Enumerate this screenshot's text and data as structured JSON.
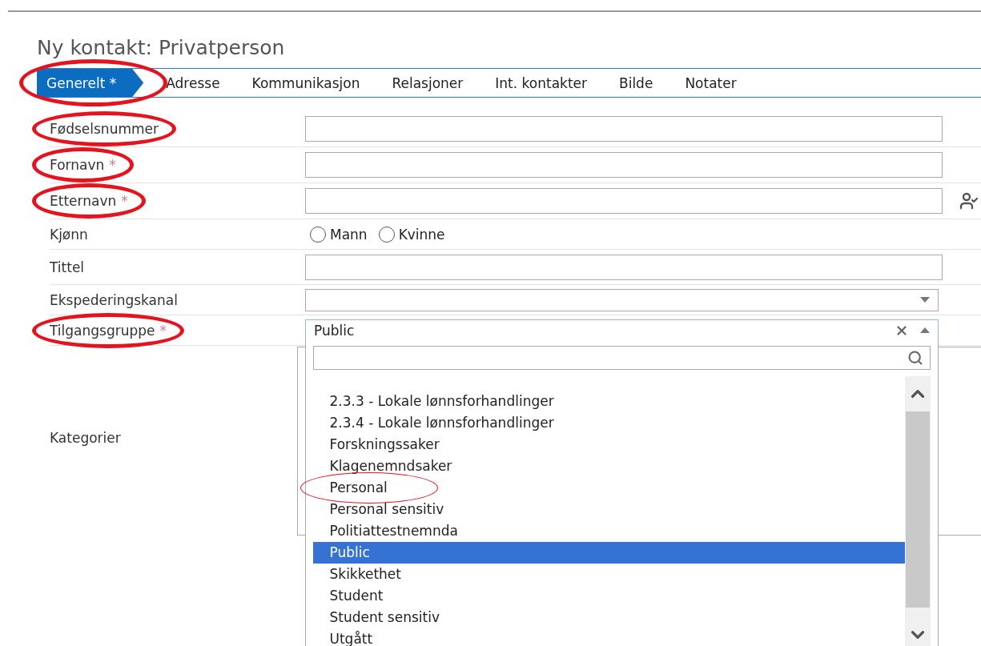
{
  "title": "Ny kontakt: Privatperson",
  "tabs": [
    {
      "label": "Generelt *",
      "selected": true,
      "circled": true
    },
    {
      "label": "Adresse",
      "selected": false
    },
    {
      "label": "Kommunikasjon",
      "selected": false
    },
    {
      "label": "Relasjoner",
      "selected": false
    },
    {
      "label": "Int. kontakter",
      "selected": false
    },
    {
      "label": "Bilde",
      "selected": false
    },
    {
      "label": "Notater",
      "selected": false
    }
  ],
  "fields": [
    {
      "kind": "text",
      "label": "Fødselsnummer",
      "circled": true
    },
    {
      "kind": "text",
      "label": "Fornavn",
      "marker": "*",
      "circled": true
    },
    {
      "kind": "text",
      "label": "Etternavn",
      "marker": "*",
      "circled": true,
      "person_check": true
    },
    {
      "kind": "radio",
      "label": "Kjønn",
      "options": [
        {
          "label": "Mann",
          "selected": false
        },
        {
          "label": "Kvinne",
          "selected": false
        }
      ]
    },
    {
      "kind": "text",
      "label": "Tittel"
    },
    {
      "kind": "select",
      "label": "Ekspederingskanal",
      "expanded": false
    },
    {
      "kind": "select",
      "label": "Tilgangsgruppe",
      "marker": "*",
      "circled": true,
      "value": "Public",
      "expanded": true
    },
    {
      "kind": "box",
      "label": "Kategorier"
    }
  ],
  "dropdown": {
    "items": [
      {
        "label": "2.3.3 - Lokale lønnsforhandlinger",
        "selected": false
      },
      {
        "label": "2.3.4 - Lokale lønnsforhandlinger",
        "selected": false
      },
      {
        "label": "Forskningssaker",
        "selected": false
      },
      {
        "label": "Klagenemndsaker",
        "selected": false
      },
      {
        "label": "Personal",
        "selected": false,
        "circled": true
      },
      {
        "label": "Personal sensitiv",
        "selected": false
      },
      {
        "label": "Politiattestnemnda",
        "selected": false
      },
      {
        "label": "Public",
        "selected": true
      },
      {
        "label": "Skikkethet",
        "selected": false
      },
      {
        "label": "Student",
        "selected": false
      },
      {
        "label": "Student sensitiv",
        "selected": false
      },
      {
        "label": "Utgått",
        "selected": false
      }
    ]
  }
}
